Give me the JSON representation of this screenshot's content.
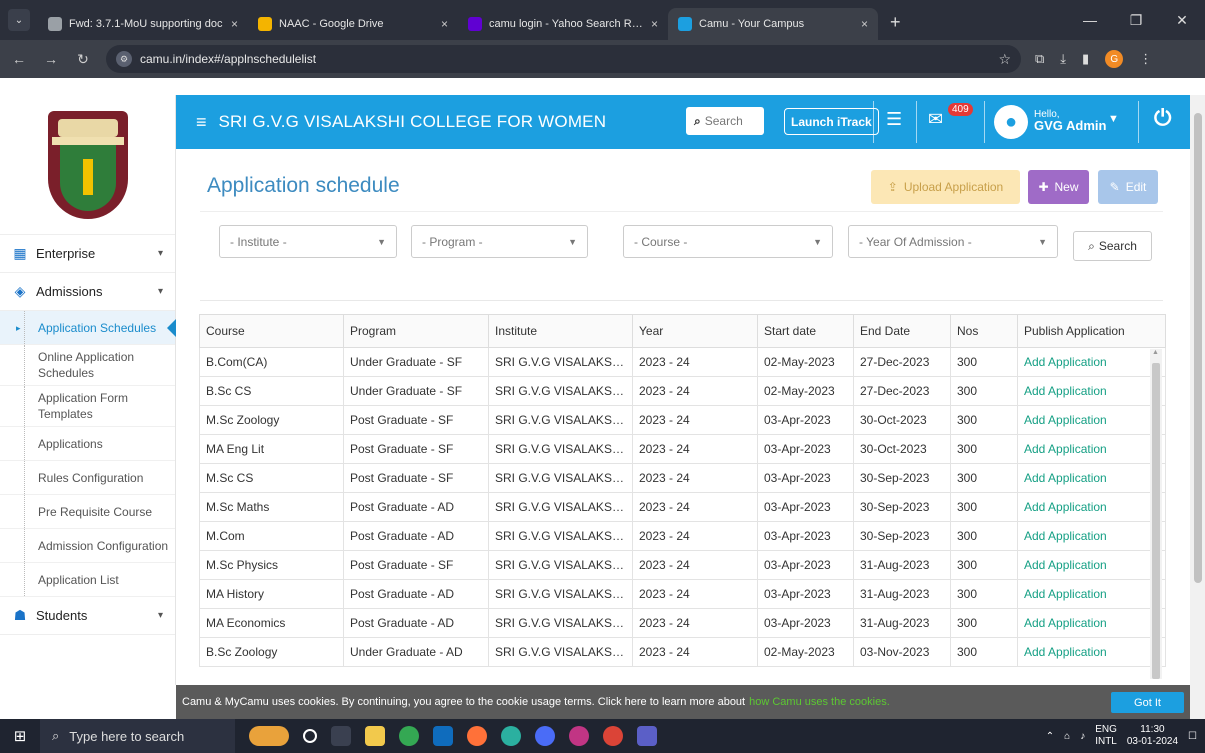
{
  "browser": {
    "tabs": [
      {
        "title": "Fwd: 3.7.1-MoU supporting doc",
        "color": "#9aa0a6",
        "active": false
      },
      {
        "title": "NAAC - Google Drive",
        "color": "#f4b400",
        "active": false
      },
      {
        "title": "camu login - Yahoo Search Resu",
        "color": "#6001d2",
        "active": false
      },
      {
        "title": "Camu - Your Campus",
        "color": "#1c9fe0",
        "active": true
      }
    ],
    "new_tab": "+",
    "url": "camu.in/index#/applnschedulelist",
    "profile_initial": "G"
  },
  "header": {
    "college_name": "SRI G.V.G VISALAKSHI COLLEGE FOR WOMEN",
    "search_placeholder": "Search",
    "launch_label": "Launch iTrack",
    "message_count": "409",
    "hello": "Hello,",
    "user_name": "GVG Admin",
    "accent": "#1c9fe0"
  },
  "sidebar": {
    "groups": [
      {
        "label": "Enterprise",
        "icon": "building-icon"
      },
      {
        "label": "Admissions",
        "icon": "admissions-icon"
      }
    ],
    "items": [
      {
        "label": "Application Schedules",
        "active": true
      },
      {
        "label": "Online Application Schedules",
        "active": false
      },
      {
        "label": "Application Form Templates",
        "active": false
      },
      {
        "label": "Applications",
        "active": false
      },
      {
        "label": "Rules Configuration",
        "active": false
      },
      {
        "label": "Pre Requisite Course",
        "active": false
      },
      {
        "label": "Admission Configuration",
        "active": false
      },
      {
        "label": "Application List",
        "active": false
      }
    ],
    "students": {
      "label": "Students",
      "icon": "students-icon"
    }
  },
  "page": {
    "title": "Application schedule",
    "upload_label": "Upload Application",
    "new_label": "New",
    "edit_label": "Edit"
  },
  "filters": {
    "institute": "- Institute -",
    "program": "- Program -",
    "course": "- Course -",
    "year": "- Year Of Admission -",
    "search_label": "Search"
  },
  "table": {
    "headers": [
      "Course",
      "Program",
      "Institute",
      "Year",
      "Start date",
      "End Date",
      "Nos",
      "Publish Application"
    ],
    "rows": [
      [
        "B.Com(CA)",
        "Under Graduate - SF",
        "SRI G.V.G VISALAKSHI C...",
        "2023 - 24",
        "02-May-2023",
        "27-Dec-2023",
        "300",
        "Add Application"
      ],
      [
        "B.Sc CS",
        "Under Graduate - SF",
        "SRI G.V.G VISALAKSHI C...",
        "2023 - 24",
        "02-May-2023",
        "27-Dec-2023",
        "300",
        "Add Application"
      ],
      [
        "M.Sc Zoology",
        "Post Graduate - SF",
        "SRI G.V.G VISALAKSHI C...",
        "2023 - 24",
        "03-Apr-2023",
        "30-Oct-2023",
        "300",
        "Add Application"
      ],
      [
        "MA Eng Lit",
        "Post Graduate - SF",
        "SRI G.V.G VISALAKSHI C...",
        "2023 - 24",
        "03-Apr-2023",
        "30-Oct-2023",
        "300",
        "Add Application"
      ],
      [
        "M.Sc CS",
        "Post Graduate - SF",
        "SRI G.V.G VISALAKSHI C...",
        "2023 - 24",
        "03-Apr-2023",
        "30-Sep-2023",
        "300",
        "Add Application"
      ],
      [
        "M.Sc Maths",
        "Post Graduate - AD",
        "SRI G.V.G VISALAKSHI C...",
        "2023 - 24",
        "03-Apr-2023",
        "30-Sep-2023",
        "300",
        "Add Application"
      ],
      [
        "M.Com",
        "Post Graduate - AD",
        "SRI G.V.G VISALAKSHI C...",
        "2023 - 24",
        "03-Apr-2023",
        "30-Sep-2023",
        "300",
        "Add Application"
      ],
      [
        "M.Sc Physics",
        "Post Graduate - SF",
        "SRI G.V.G VISALAKSHI C...",
        "2023 - 24",
        "03-Apr-2023",
        "31-Aug-2023",
        "300",
        "Add Application"
      ],
      [
        "MA History",
        "Post Graduate - AD",
        "SRI G.V.G VISALAKSHI C...",
        "2023 - 24",
        "03-Apr-2023",
        "31-Aug-2023",
        "300",
        "Add Application"
      ],
      [
        "MA Economics",
        "Post Graduate - AD",
        "SRI G.V.G VISALAKSHI C...",
        "2023 - 24",
        "03-Apr-2023",
        "31-Aug-2023",
        "300",
        "Add Application"
      ],
      [
        "B.Sc Zoology",
        "Under Graduate - AD",
        "SRI G.V.G VISALAKSHI C...",
        "2023 - 24",
        "02-May-2023",
        "03-Nov-2023",
        "300",
        "Add Application"
      ]
    ]
  },
  "cookie": {
    "text": "Camu & MyCamu uses cookies. By continuing, you agree to the cookie usage terms. Click here to learn more about",
    "link": "how Camu uses the cookies.",
    "button": "Got It"
  },
  "taskbar": {
    "search_placeholder": "Type here to search",
    "lang_top": "ENG",
    "lang_bottom": "INTL",
    "time": "11:30",
    "date": "03-01-2024"
  }
}
